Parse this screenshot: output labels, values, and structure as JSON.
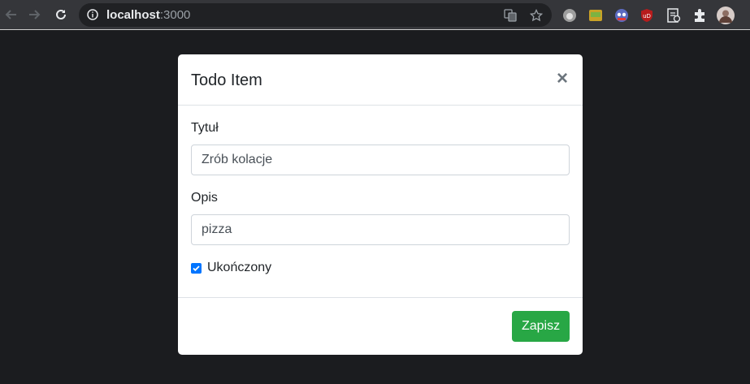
{
  "browser": {
    "url_host": "localhost",
    "url_port": ":3000",
    "nav_icons": [
      "back-icon",
      "forward-icon",
      "reload-icon"
    ],
    "omnibox_icons": [
      "info-icon",
      "translate-icon",
      "star-icon"
    ],
    "extension_icons": [
      "extension-1-icon",
      "extension-2-icon",
      "extension-3-icon",
      "ublock-icon",
      "extension-5-icon",
      "puzzle-icon",
      "profile-avatar"
    ],
    "ublock_text": "uD"
  },
  "modal": {
    "title": "Todo Item",
    "close_symbol": "×",
    "fields": {
      "title_label": "Tytuł",
      "title_value": "Zrób kolacje",
      "description_label": "Opis",
      "description_value": "pizza"
    },
    "completed": {
      "label": "Ukończony",
      "checked": true
    },
    "save_label": "Zapisz"
  },
  "colors": {
    "background": "#1b1c1f",
    "toolbar": "#35363a",
    "primary_button": "#28a745",
    "checkbox": "#0075ff"
  }
}
